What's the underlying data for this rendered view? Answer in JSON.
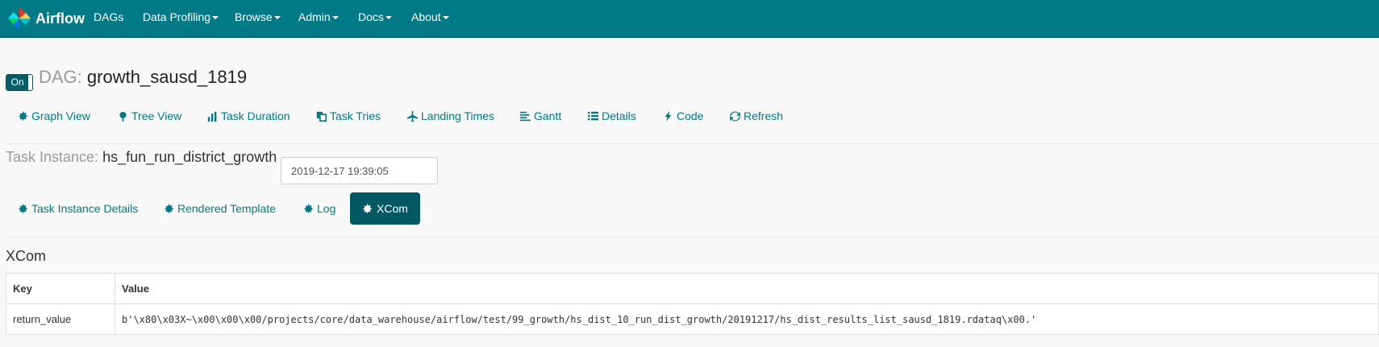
{
  "navbar": {
    "brand": "Airflow",
    "items": [
      {
        "label": "DAGs",
        "dropdown": false
      },
      {
        "label": "Data Profiling",
        "dropdown": true
      },
      {
        "label": "Browse",
        "dropdown": true
      },
      {
        "label": "Admin",
        "dropdown": true
      },
      {
        "label": "Docs",
        "dropdown": true
      },
      {
        "label": "About",
        "dropdown": true
      }
    ]
  },
  "dag": {
    "toggle_label": "On",
    "title_prefix": "DAG:",
    "name": "growth_sausd_1819",
    "views": [
      {
        "label": "Graph View",
        "icon": "graph-icon"
      },
      {
        "label": "Tree View",
        "icon": "tree-icon"
      },
      {
        "label": "Task Duration",
        "icon": "bar-chart-icon"
      },
      {
        "label": "Task Tries",
        "icon": "duplicate-icon"
      },
      {
        "label": "Landing Times",
        "icon": "plane-icon"
      },
      {
        "label": "Gantt",
        "icon": "align-left-icon"
      },
      {
        "label": "Details",
        "icon": "list-icon"
      },
      {
        "label": "Code",
        "icon": "flash-icon"
      },
      {
        "label": "Refresh",
        "icon": "refresh-icon"
      }
    ]
  },
  "task_instance": {
    "title_prefix": "Task Instance:",
    "name": "hs_fun_run_district_growth",
    "execution_date": "2019-12-17 19:39:05",
    "tabs": [
      {
        "label": "Task Instance Details",
        "icon": "graph-icon"
      },
      {
        "label": "Rendered Template",
        "icon": "graph-icon"
      },
      {
        "label": "Log",
        "icon": "graph-icon"
      },
      {
        "label": "XCom",
        "icon": "graph-icon",
        "active": true
      }
    ]
  },
  "xcom": {
    "title": "XCom",
    "columns": [
      "Key",
      "Value"
    ],
    "rows": [
      {
        "key": "return_value",
        "value": "b'\\x80\\x03X~\\x00\\x00\\x00/projects/core/data_warehouse/airflow/test/99_growth/hs_dist_10_run_dist_growth/20191217/hs_dist_results_list_sausd_1819.rdataq\\x00.'"
      }
    ]
  },
  "colors": {
    "navbar": "#017a87",
    "link": "#017a87",
    "active_pill": "#025964"
  }
}
